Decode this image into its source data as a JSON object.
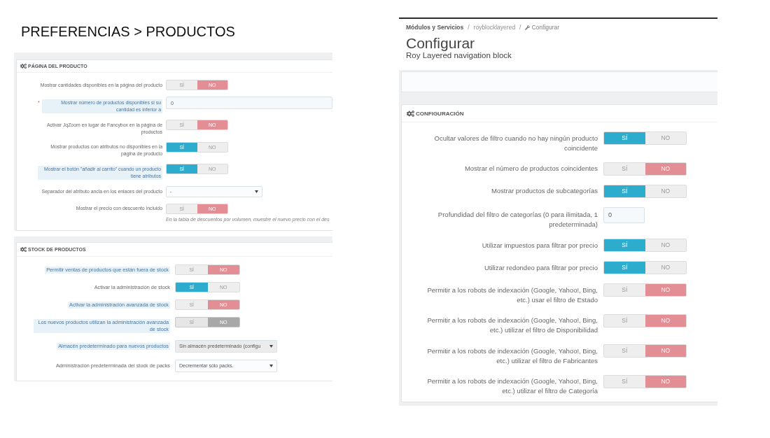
{
  "slide_title": "PREFERENCIAS > PRODUCTOS",
  "left_screenshots": [
    {
      "header": "PÁGINA DEL PRODUCTO",
      "rows": [
        {
          "kind": "toggle",
          "label": "Mostrar cantidades disponibles en la página del producto",
          "highlighted": false,
          "disabled": false,
          "options": [
            {
              "label": "SÍ",
              "selected": false
            },
            {
              "label": "NO",
              "selected": true
            }
          ]
        },
        {
          "kind": "input",
          "required_mark": "*",
          "label": "Mostrar número de productos disponibles si su cantidad es inferior a",
          "highlighted": true,
          "disabled": false,
          "value": "0"
        },
        {
          "kind": "toggle",
          "label": "Activar JqZoom en lugar de Fancybox en la página de productos",
          "highlighted": false,
          "disabled": false,
          "options": [
            {
              "label": "SÍ",
              "selected": false
            },
            {
              "label": "NO",
              "selected": true
            }
          ]
        },
        {
          "kind": "toggle",
          "label": "Mostrar productos con atributos no disponibles en la página de producto",
          "highlighted": false,
          "disabled": false,
          "options": [
            {
              "label": "SÍ",
              "selected": true
            },
            {
              "label": "NO",
              "selected": false
            }
          ]
        },
        {
          "kind": "toggle",
          "label": "Mostrar el botón \"añadir al carrito\" cuando un producto tiene atributos",
          "highlighted": true,
          "disabled": false,
          "options": [
            {
              "label": "SÍ",
              "selected": true
            },
            {
              "label": "NO",
              "selected": false
            }
          ]
        },
        {
          "kind": "select",
          "label": "Separador del atributo ancla en los enlaces del producto",
          "highlighted": false,
          "disabled": false,
          "value": "-"
        },
        {
          "kind": "toggle",
          "label": "Mostrar el precio con descuento incluido",
          "highlighted": false,
          "disabled": false,
          "options": [
            {
              "label": "SÍ",
              "selected": false
            },
            {
              "label": "NO",
              "selected": true
            }
          ],
          "help": "En la tabla de descuentos por volumen, muestre el nuevo precio con el des"
        }
      ]
    },
    {
      "header": "STOCK DE PRODUCTOS",
      "rows": [
        {
          "kind": "toggle",
          "label": "Permitir ventas de productos que están fuera de stock",
          "highlighted": true,
          "disabled": false,
          "options": [
            {
              "label": "SÍ",
              "selected": false
            },
            {
              "label": "NO",
              "selected": true
            }
          ]
        },
        {
          "kind": "toggle",
          "label": "Activar la administración de stock",
          "highlighted": false,
          "disabled": false,
          "options": [
            {
              "label": "SÍ",
              "selected": true
            },
            {
              "label": "NO",
              "selected": false
            }
          ]
        },
        {
          "kind": "toggle",
          "label": "Activar la administración avanzada de stock",
          "highlighted": true,
          "disabled": false,
          "options": [
            {
              "label": "SÍ",
              "selected": false
            },
            {
              "label": "NO",
              "selected": true
            }
          ]
        },
        {
          "kind": "toggle",
          "label": "Los nuevos productos utilizan la administración avanzada de stock",
          "highlighted": true,
          "disabled": true,
          "options": [
            {
              "label": "SÍ",
              "selected": false
            },
            {
              "label": "NO",
              "selected": true
            }
          ]
        },
        {
          "kind": "select",
          "label": "Almacén predeterminado para nuevos productos",
          "highlighted": true,
          "disabled": true,
          "value": "Sin almacén predeterminado (configu"
        },
        {
          "kind": "select",
          "label": "Administración predeterminada del stock de packs",
          "highlighted": false,
          "disabled": false,
          "value": "Decrementar sólo packs."
        }
      ]
    }
  ],
  "right_screenshot": {
    "breadcrumb": [
      {
        "kind": "section",
        "label": "Módulos y Servicios"
      },
      {
        "kind": "separator",
        "label": "/"
      },
      {
        "kind": "module",
        "label": "royblocklayered"
      },
      {
        "kind": "separator",
        "label": "/"
      },
      {
        "kind": "current",
        "label": "Configurar"
      }
    ],
    "title": "Configurar",
    "subtitle": "Roy Layered navigation block",
    "panel": {
      "header": "CONFIGURACIÓN",
      "rows": [
        {
          "kind": "toggle",
          "label": "Ocultar valores de filtro cuando no hay ningún producto coincidente",
          "highlighted": false,
          "disabled": false,
          "options": [
            {
              "label": "SÍ",
              "selected": true
            },
            {
              "label": "NO",
              "selected": false
            }
          ]
        },
        {
          "kind": "toggle",
          "label": "Mostrar el número de productos coincidentes",
          "highlighted": false,
          "disabled": false,
          "options": [
            {
              "label": "SÍ",
              "selected": false
            },
            {
              "label": "NO",
              "selected": true
            }
          ]
        },
        {
          "kind": "toggle",
          "label": "Mostrar productos de subcategorías",
          "highlighted": false,
          "disabled": false,
          "options": [
            {
              "label": "SÍ",
              "selected": true
            },
            {
              "label": "NO",
              "selected": false
            }
          ]
        },
        {
          "kind": "input",
          "label": "Profundidad del filtro de categorías (0 para ilimitada, 1 predeterminada)",
          "highlighted": false,
          "disabled": false,
          "value": "0"
        },
        {
          "kind": "toggle",
          "label": "Utilizar impuestos para filtrar por precio",
          "highlighted": false,
          "disabled": false,
          "options": [
            {
              "label": "SÍ",
              "selected": true
            },
            {
              "label": "NO",
              "selected": false
            }
          ]
        },
        {
          "kind": "toggle",
          "label": "Utilizar redondeo para filtrar por precio",
          "highlighted": false,
          "disabled": false,
          "options": [
            {
              "label": "SÍ",
              "selected": true
            },
            {
              "label": "NO",
              "selected": false
            }
          ]
        },
        {
          "kind": "toggle",
          "label": "Permitir a los robots de indexación (Google, Yahoo!, Bing, etc.) usar el filtro de Estado",
          "highlighted": false,
          "disabled": false,
          "options": [
            {
              "label": "SÍ",
              "selected": false
            },
            {
              "label": "NO",
              "selected": true
            }
          ]
        },
        {
          "kind": "toggle",
          "label": "Permitir a los robots de indexación (Google, Yahoo!, Bing, etc.) utilizar el filtro de Disponibilidad",
          "highlighted": false,
          "disabled": false,
          "options": [
            {
              "label": "SÍ",
              "selected": false
            },
            {
              "label": "NO",
              "selected": true
            }
          ]
        },
        {
          "kind": "toggle",
          "label": "Permitir a los robots de indexación (Google, Yahoo!, Bing, etc.) utilizar el filtro de Fabricantes",
          "highlighted": false,
          "disabled": false,
          "options": [
            {
              "label": "SÍ",
              "selected": false
            },
            {
              "label": "NO",
              "selected": true
            }
          ]
        },
        {
          "kind": "toggle",
          "label": "Permitir a los robots de indexación (Google, Yahoo!, Bing, etc.) utilizar el filtro de Categoría",
          "highlighted": false,
          "disabled": false,
          "options": [
            {
              "label": "SÍ",
              "selected": false
            },
            {
              "label": "NO",
              "selected": true
            }
          ]
        }
      ]
    }
  }
}
